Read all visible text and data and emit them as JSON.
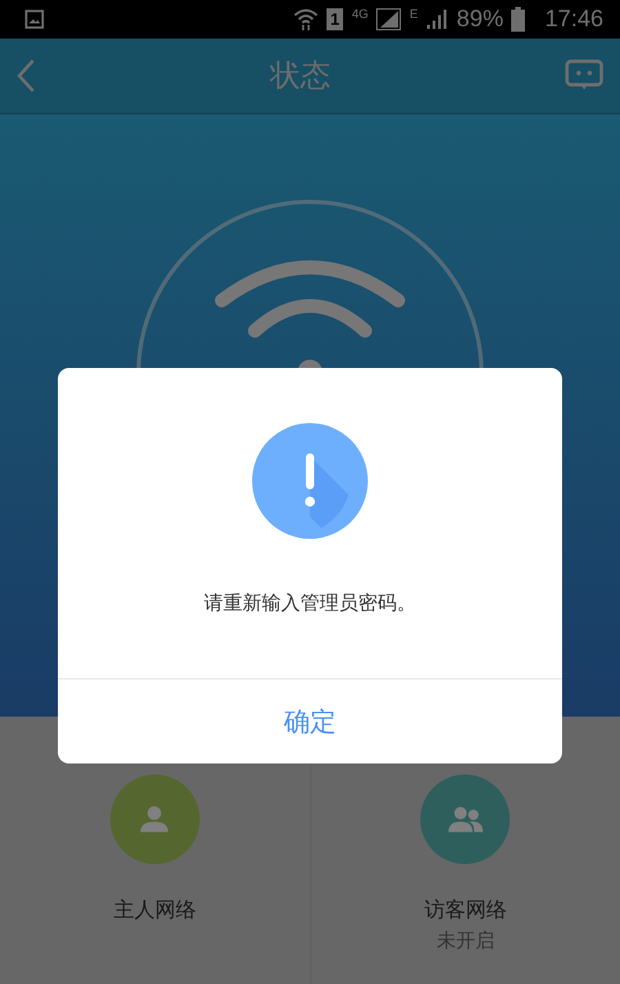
{
  "status_bar": {
    "sim": "1",
    "network": "4G",
    "network_2": "E",
    "battery": "89%",
    "time": "17:46"
  },
  "header": {
    "title": "状态"
  },
  "networks": [
    {
      "label": "主人网络",
      "kind": "host",
      "color": "#55672f"
    },
    {
      "label": "访客网络",
      "kind": "guest",
      "color": "#2f5f5d",
      "status": "未开启"
    }
  ],
  "dialog": {
    "message": "请重新输入管理员密码。",
    "button": "确定"
  }
}
